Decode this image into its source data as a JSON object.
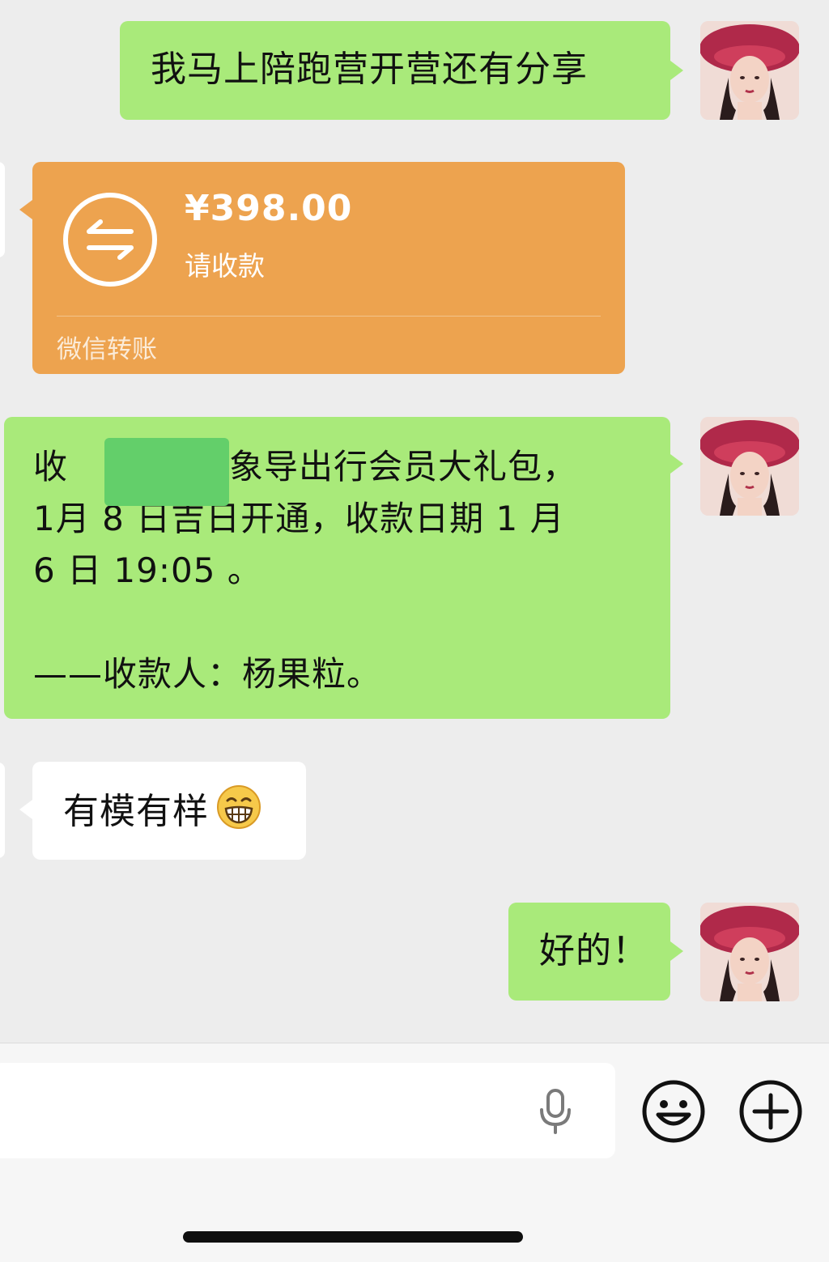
{
  "messages": [
    {
      "id": "m1",
      "side": "right",
      "type": "text",
      "text": "我马上陪跑营开营还有分享"
    },
    {
      "id": "m2",
      "side": "left",
      "type": "transfer",
      "amount": "¥398.00",
      "subtitle": "请收款",
      "footer": "微信转账"
    },
    {
      "id": "m3",
      "side": "right",
      "type": "text",
      "lines": [
        "收",
        "大象导出行会员大礼包，",
        "1月 8 日吉日开通，收款日期 1 月",
        "6 日 19:05 。",
        "——收款人：杨果粒。"
      ]
    },
    {
      "id": "m4",
      "side": "left",
      "type": "text",
      "text": "有模有样",
      "emoji": "grinning-face-emoji"
    },
    {
      "id": "m5",
      "side": "right",
      "type": "text",
      "text": "好的！"
    }
  ],
  "colors": {
    "background": "#ededed",
    "bubble_sent": "#a9ea7a",
    "bubble_received": "#ffffff",
    "transfer_card": "#eda34f",
    "redaction": "#63cf6a"
  },
  "input_bar": {
    "placeholder": "",
    "voice_icon": "microphone-icon",
    "emoji_icon": "smiley-face-icon",
    "more_icon": "plus-circle-icon"
  }
}
